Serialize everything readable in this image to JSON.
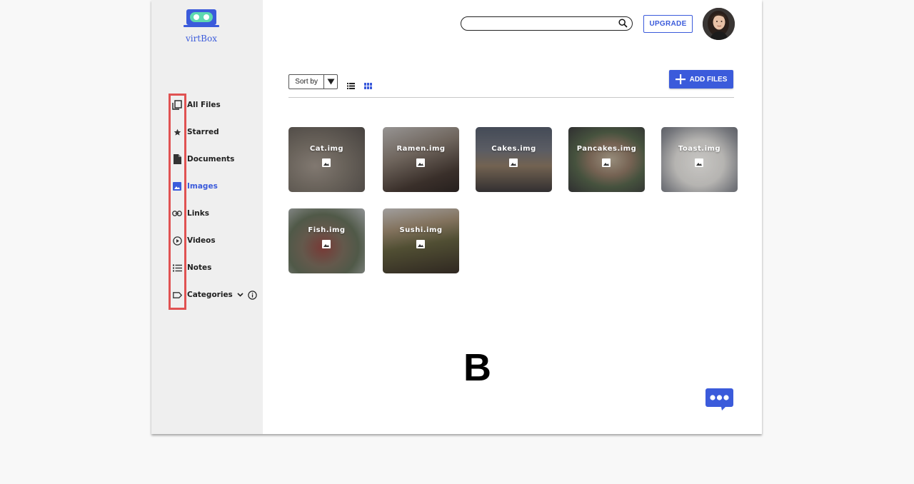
{
  "app": {
    "name": "virtBox"
  },
  "sidebar": {
    "items": [
      {
        "label": "All Files",
        "icon": "copy-icon",
        "active": false
      },
      {
        "label": "Starred",
        "icon": "star-icon",
        "active": false
      },
      {
        "label": "Documents",
        "icon": "document-icon",
        "active": false
      },
      {
        "label": "Images",
        "icon": "image-icon",
        "active": true
      },
      {
        "label": "Links",
        "icon": "link-icon",
        "active": false
      },
      {
        "label": "Videos",
        "icon": "play-circle-icon",
        "active": false
      },
      {
        "label": "Notes",
        "icon": "list-icon",
        "active": false
      },
      {
        "label": "Categories",
        "icon": "label-icon",
        "active": false
      }
    ]
  },
  "header": {
    "search": {
      "value": "",
      "placeholder": ""
    },
    "upgrade_label": "UPGRADE"
  },
  "toolbar": {
    "sort_label": "Sort by",
    "add_files_label": "ADD FILES"
  },
  "files": [
    {
      "name": "Cat.img"
    },
    {
      "name": "Ramen.img"
    },
    {
      "name": "Cakes.img"
    },
    {
      "name": "Pancakes.img"
    },
    {
      "name": "Toast.img"
    },
    {
      "name": "Fish.img"
    },
    {
      "name": "Sushi.img"
    }
  ],
  "overlay_letter": "B",
  "colors": {
    "accent": "#3b5bdb",
    "highlight": "#e05252",
    "sidebar_bg": "#efefef"
  }
}
